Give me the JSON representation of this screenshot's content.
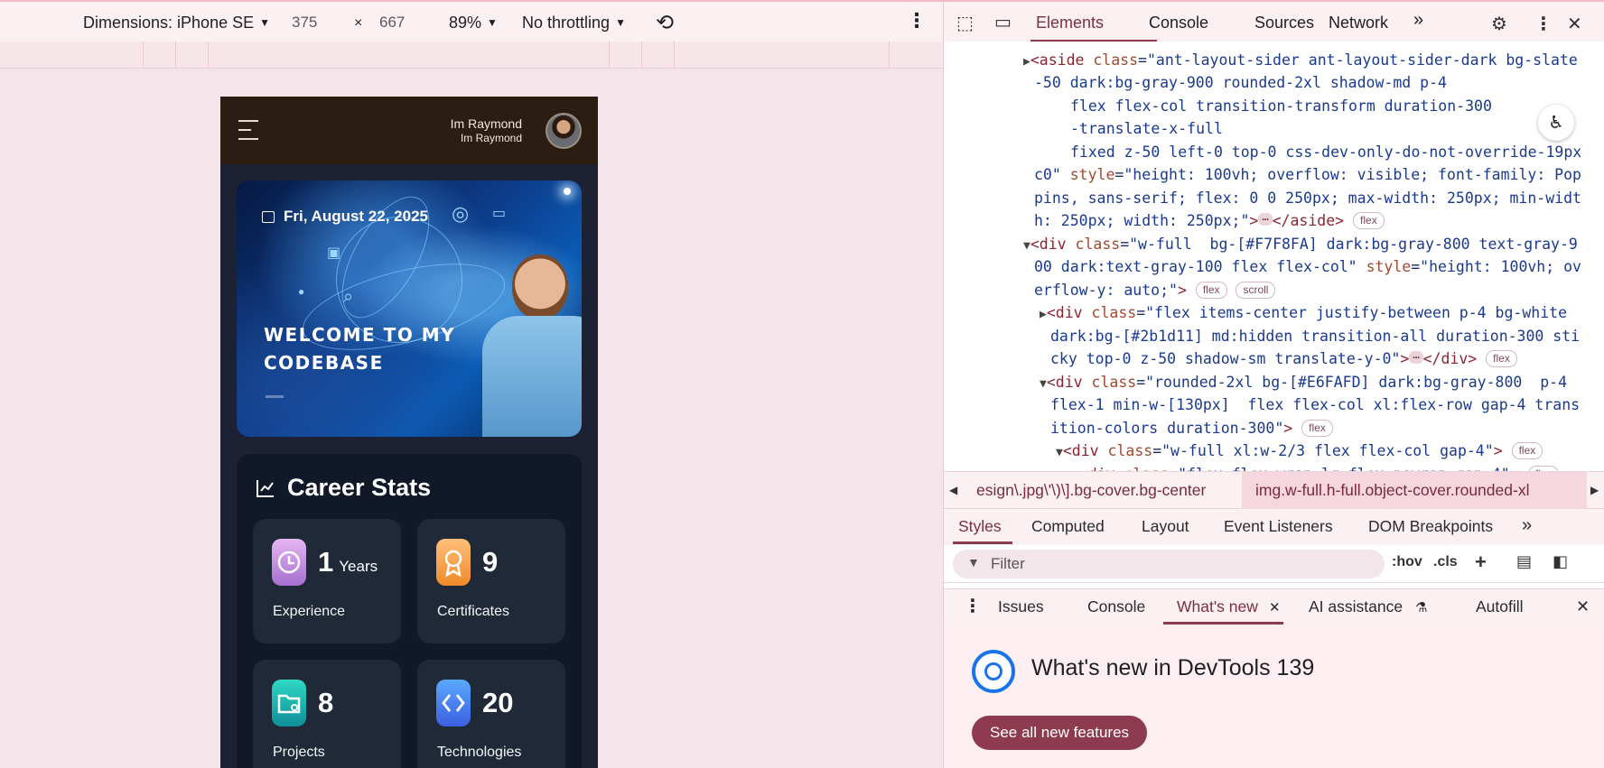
{
  "device_toolbar": {
    "dimensions_label": "Dimensions: iPhone SE",
    "width": "375",
    "times": "×",
    "height": "667",
    "zoom": "89%",
    "throttling": "No throttling"
  },
  "app": {
    "user_name": "Im Raymond",
    "user_subtitle": "Im Raymond",
    "banner": {
      "date": "Fri, August 22, 2025",
      "title": "WELCOME TO MY CODEBASE"
    },
    "stats": {
      "title": "Career Stats",
      "cards": [
        {
          "value": "1",
          "unit": "Years",
          "label": "Experience",
          "icon": "clock-icon",
          "color": "#c38be0"
        },
        {
          "value": "9",
          "unit": "",
          "label": "Certificates",
          "icon": "award-icon",
          "color": "#f5a54a"
        },
        {
          "value": "8",
          "unit": "",
          "label": "Projects",
          "icon": "folder-icon",
          "color": "#1bbfb0"
        },
        {
          "value": "20",
          "unit": "",
          "label": "Technologies",
          "icon": "code-icon",
          "color": "#3b82f6"
        }
      ]
    }
  },
  "devtools": {
    "tabs": [
      "Elements",
      "Console",
      "Sources",
      "Network"
    ],
    "active_tab": "Elements",
    "more_tabs": "»",
    "dom_pills": {
      "flex": "flex",
      "scroll": "scroll"
    },
    "breadcrumbs": [
      "esign\\.jpg\\'\\)\\].bg-cover.bg-center",
      "img.w-full.h-full.object-cover.rounded-xl"
    ],
    "styles_tabs": [
      "Styles",
      "Computed",
      "Layout",
      "Event Listeners",
      "DOM Breakpoints"
    ],
    "filter_placeholder": "Filter",
    "hov": ":hov",
    "cls": ".cls",
    "drawer_tabs": [
      "Issues",
      "Console",
      "What's new",
      "AI assistance",
      "Autofill"
    ],
    "whats_new_title": "What's new in DevTools 139",
    "whats_new_button": "See all new features"
  }
}
